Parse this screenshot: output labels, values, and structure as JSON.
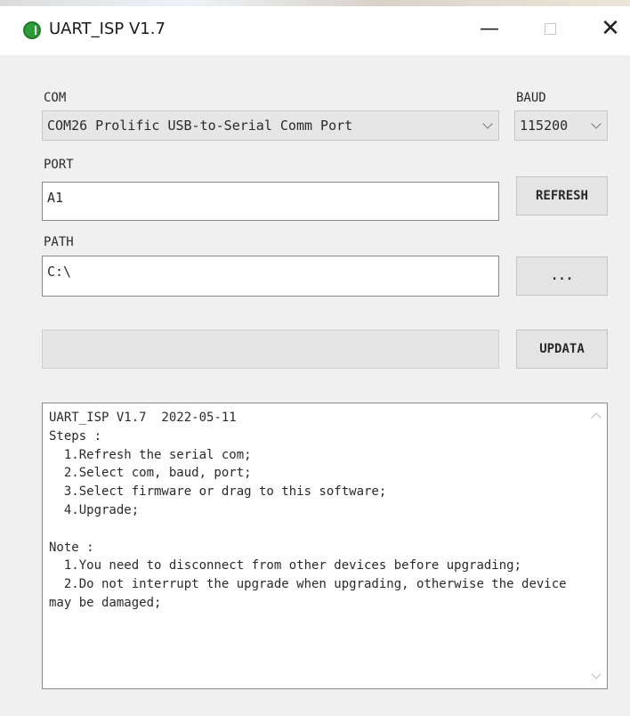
{
  "window": {
    "title": "UART_ISP V1.7",
    "icon": "power-icon",
    "controls": {
      "minimize": "—",
      "close": "✕"
    }
  },
  "com": {
    "label": "COM",
    "value": "COM26 Prolific USB-to-Serial Comm Port"
  },
  "baud": {
    "label": "BAUD",
    "value": "115200"
  },
  "port": {
    "label": "PORT",
    "value": "A1",
    "button": "REFRESH"
  },
  "path": {
    "label": "PATH",
    "value": "C:\\",
    "button": "..."
  },
  "progress": {
    "fraction": 0,
    "button": "UPDATA"
  },
  "log": {
    "text": "UART_ISP V1.7  2022-05-11\nSteps :\n  1.Refresh the serial com;\n  2.Select com, baud, port;\n  3.Select firmware or drag to this software;\n  4.Upgrade;\n\nNote :\n  1.You need to disconnect from other devices before upgrading;\n  2.Do not interrupt the upgrade when upgrading, otherwise the device may be damaged;"
  },
  "colors": {
    "progress_fill": "#06b025",
    "app_icon": "#2e9b3a"
  }
}
